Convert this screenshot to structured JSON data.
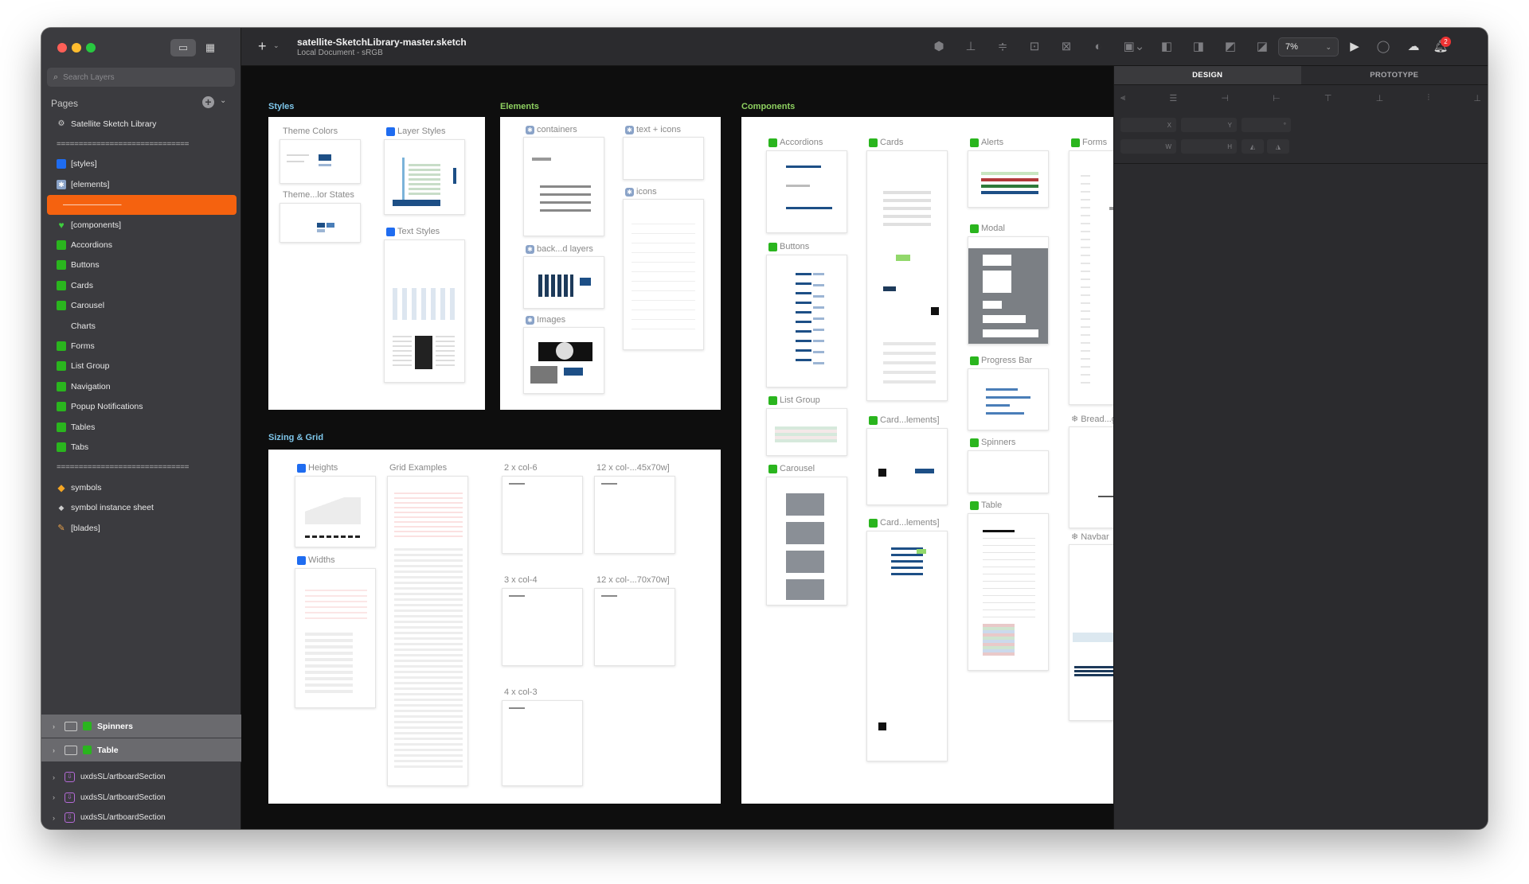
{
  "window": {
    "document_title": "satellite-SketchLibrary-master.sketch",
    "document_subtitle": "Local Document - sRGB"
  },
  "sidebar": {
    "search_placeholder": "Search Layers",
    "pages_header": "Pages",
    "pages": [
      {
        "label": "Satellite Sketch Library",
        "icon": "gear-icon",
        "kind": "item"
      },
      {
        "label": "==============================",
        "icon": "",
        "kind": "separator"
      },
      {
        "label": "[styles]",
        "icon": "blue-square-icon",
        "kind": "item"
      },
      {
        "label": "[elements]",
        "icon": "gear-square-icon",
        "kind": "item"
      },
      {
        "label": "———————",
        "icon": "",
        "kind": "selected"
      },
      {
        "label": "[components]",
        "icon": "green-heart-icon",
        "kind": "item"
      },
      {
        "label": "Accordions",
        "icon": "green-square-icon",
        "kind": "item"
      },
      {
        "label": "Buttons",
        "icon": "green-square-icon",
        "kind": "item"
      },
      {
        "label": "Cards",
        "icon": "green-square-icon",
        "kind": "item"
      },
      {
        "label": "Carousel",
        "icon": "green-square-icon",
        "kind": "item"
      },
      {
        "label": "Charts",
        "icon": "",
        "kind": "item"
      },
      {
        "label": "Forms",
        "icon": "green-square-icon",
        "kind": "item"
      },
      {
        "label": "List Group",
        "icon": "green-square-icon",
        "kind": "item"
      },
      {
        "label": "Navigation",
        "icon": "green-square-icon",
        "kind": "item"
      },
      {
        "label": "Popup Notifications",
        "icon": "green-square-icon",
        "kind": "item"
      },
      {
        "label": "Tables",
        "icon": "green-square-icon",
        "kind": "item"
      },
      {
        "label": "Tabs",
        "icon": "green-square-icon",
        "kind": "item"
      },
      {
        "label": "==============================",
        "icon": "",
        "kind": "separator"
      },
      {
        "label": "symbols",
        "icon": "orange-diamond-icon",
        "kind": "item"
      },
      {
        "label": "symbol instance sheet",
        "icon": "diamond-icon",
        "kind": "item"
      },
      {
        "label": "[blades]",
        "icon": "brush-icon",
        "kind": "item"
      }
    ],
    "layers": [
      {
        "label": "Spinners"
      },
      {
        "label": "Table"
      }
    ],
    "sections": [
      {
        "label": "uxdsSL/artboardSection"
      },
      {
        "label": "uxdsSL/artboardSection"
      },
      {
        "label": "uxdsSL/artboardSection"
      }
    ]
  },
  "toolbar": {
    "zoom": "7%",
    "notification_count": "2"
  },
  "inspector": {
    "tabs": [
      "DESIGN",
      "PROTOTYPE"
    ],
    "active_tab": "DESIGN",
    "fields": {
      "x": "X",
      "y": "Y",
      "w": "W",
      "h": "H"
    }
  },
  "canvas": {
    "groups": {
      "styles": "Styles",
      "elements": "Elements",
      "components": "Components",
      "sizing": "Sizing & Grid"
    },
    "artboards": {
      "theme_colors": "Theme Colors",
      "layer_styles": "Layer Styles",
      "theme_states": "Theme...lor States",
      "text_styles": "Text Styles",
      "containers": "containers",
      "text_icons": "text + icons",
      "icons": "icons",
      "back_layers": "back...d layers",
      "images": "Images",
      "accordions": "Accordions",
      "cards": "Cards",
      "alerts": "Alerts",
      "forms": "Forms",
      "buttons": "Buttons",
      "modal": "Modal",
      "progress_bar": "Progress Bar",
      "list_group": "List Group",
      "card_elements_1": "Card...lements]",
      "spinners": "Spinners",
      "bread": "Bread...gination",
      "carousel": "Carousel",
      "card_elements_2": "Card...lements]",
      "table": "Table",
      "navbar": "Navbar",
      "heights": "Heights",
      "grid_examples": "Grid Examples",
      "col6": "2 x col-6",
      "col12a": "12 x col-...45x70w]",
      "widths": "Widths",
      "col4": "3 x col-4",
      "col12b": "12 x col-...70x70w]",
      "col3": "4 x col-3"
    }
  }
}
